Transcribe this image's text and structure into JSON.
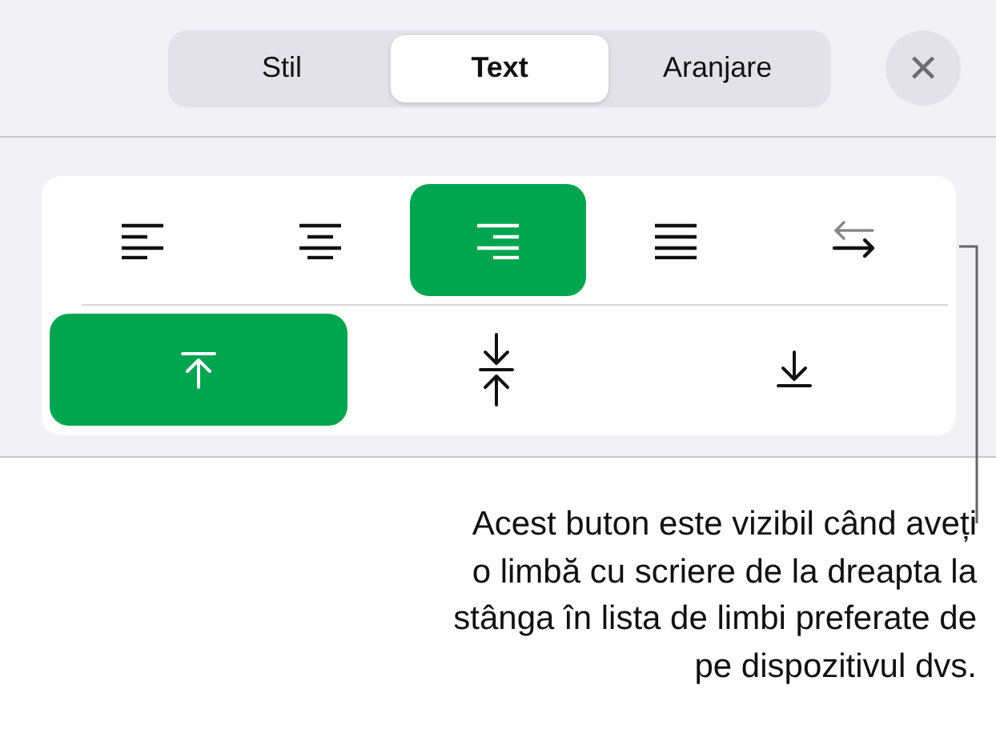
{
  "tabs": [
    {
      "label": "Stil",
      "selected": false
    },
    {
      "label": "Text",
      "selected": true
    },
    {
      "label": "Aranjare",
      "selected": false
    }
  ],
  "close_button": {
    "label": "✕"
  },
  "alignment_buttons": [
    {
      "kind": "align-left",
      "selected": false
    },
    {
      "kind": "align-center",
      "selected": false
    },
    {
      "kind": "align-right",
      "selected": true
    },
    {
      "kind": "justify",
      "selected": false
    },
    {
      "kind": "text-direction",
      "selected": false
    }
  ],
  "vertical_buttons": [
    {
      "kind": "top",
      "selected": true
    },
    {
      "kind": "middle",
      "selected": false
    },
    {
      "kind": "bottom",
      "selected": false
    }
  ],
  "callout": {
    "lines": [
      "Acest buton este vizibil când aveți",
      "o limbă cu scriere de la dreapta la",
      "stânga în lista de limbi preferate de",
      "pe dispozitivul dvs."
    ]
  }
}
